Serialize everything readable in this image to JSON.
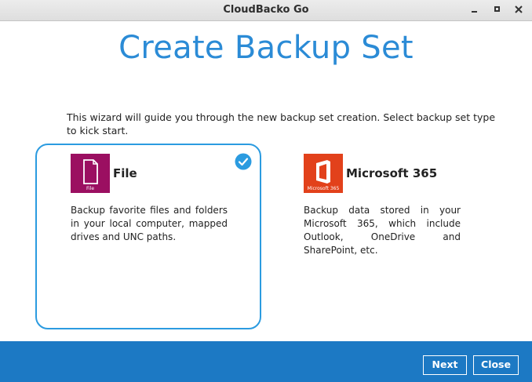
{
  "window": {
    "title": "CloudBacko Go"
  },
  "page": {
    "title": "Create Backup Set",
    "intro": "This wizard will guide you through the new backup set creation. Select backup set type to kick start."
  },
  "options": [
    {
      "name": "File",
      "icon": "file-icon",
      "icon_caption": "File",
      "description": "Backup favorite files and folders in your local computer, mapped drives and UNC paths.",
      "selected": true
    },
    {
      "name": "Microsoft 365",
      "icon": "office-icon",
      "icon_caption": "Microsoft 365",
      "description": "Backup data stored in your Microsoft 365, which include Outlook, OneDrive and SharePoint, etc.",
      "selected": false
    }
  ],
  "footer": {
    "next_label": "Next",
    "close_label": "Close"
  },
  "colors": {
    "accent": "#2b8bd6",
    "footer": "#1c79c4",
    "file_brand": "#9b0f61",
    "office_brand": "#e2411b"
  }
}
